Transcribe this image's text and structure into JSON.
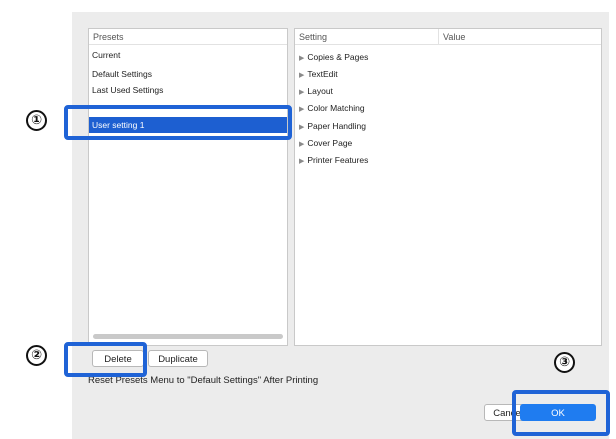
{
  "presets": {
    "header": "Presets",
    "items": [
      {
        "label": "Current",
        "selected": false
      },
      {
        "label": "Default Settings",
        "selected": false
      },
      {
        "label": "Last Used Settings",
        "selected": false
      },
      {
        "label": "User setting 1",
        "selected": true
      }
    ]
  },
  "settings": {
    "header_setting": "Setting",
    "header_value": "Value",
    "items": [
      "Copies & Pages",
      "TextEdit",
      "Layout",
      "Color Matching",
      "Paper Handling",
      "Cover Page",
      "Printer Features"
    ],
    "expand_icon": "disclosure-triangle-icon"
  },
  "buttons": {
    "delete": "Delete",
    "duplicate": "Duplicate",
    "cancel": "Cancel",
    "ok": "OK"
  },
  "checkbox": {
    "label": "Reset Presets Menu to \"Default Settings\" After Printing",
    "checked": false
  },
  "callouts": {
    "one": "①",
    "two": "②",
    "three": "③"
  },
  "colors": {
    "accent": "#1f7cf0",
    "selection": "#1d5fd1",
    "callout": "#1f63d6"
  }
}
